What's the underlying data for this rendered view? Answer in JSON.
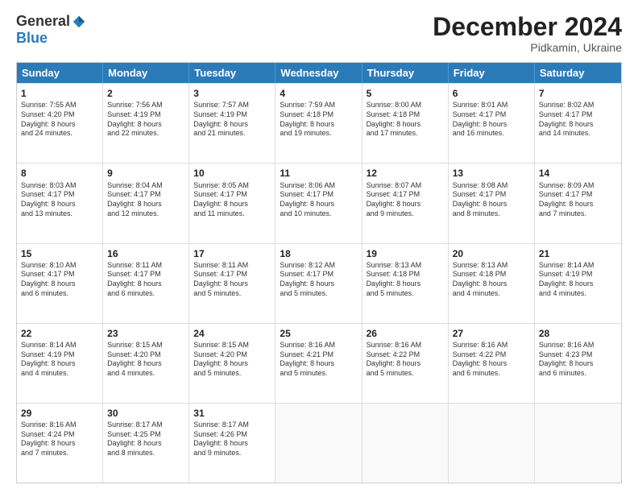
{
  "logo": {
    "general": "General",
    "blue": "Blue"
  },
  "header": {
    "month": "December 2024",
    "location": "Pidkamin, Ukraine"
  },
  "days": [
    "Sunday",
    "Monday",
    "Tuesday",
    "Wednesday",
    "Thursday",
    "Friday",
    "Saturday"
  ],
  "weeks": [
    [
      {
        "day": "1",
        "info": "Sunrise: 7:55 AM\nSunset: 4:20 PM\nDaylight: 8 hours\nand 24 minutes."
      },
      {
        "day": "2",
        "info": "Sunrise: 7:56 AM\nSunset: 4:19 PM\nDaylight: 8 hours\nand 22 minutes."
      },
      {
        "day": "3",
        "info": "Sunrise: 7:57 AM\nSunset: 4:19 PM\nDaylight: 8 hours\nand 21 minutes."
      },
      {
        "day": "4",
        "info": "Sunrise: 7:59 AM\nSunset: 4:18 PM\nDaylight: 8 hours\nand 19 minutes."
      },
      {
        "day": "5",
        "info": "Sunrise: 8:00 AM\nSunset: 4:18 PM\nDaylight: 8 hours\nand 17 minutes."
      },
      {
        "day": "6",
        "info": "Sunrise: 8:01 AM\nSunset: 4:17 PM\nDaylight: 8 hours\nand 16 minutes."
      },
      {
        "day": "7",
        "info": "Sunrise: 8:02 AM\nSunset: 4:17 PM\nDaylight: 8 hours\nand 14 minutes."
      }
    ],
    [
      {
        "day": "8",
        "info": "Sunrise: 8:03 AM\nSunset: 4:17 PM\nDaylight: 8 hours\nand 13 minutes."
      },
      {
        "day": "9",
        "info": "Sunrise: 8:04 AM\nSunset: 4:17 PM\nDaylight: 8 hours\nand 12 minutes."
      },
      {
        "day": "10",
        "info": "Sunrise: 8:05 AM\nSunset: 4:17 PM\nDaylight: 8 hours\nand 11 minutes."
      },
      {
        "day": "11",
        "info": "Sunrise: 8:06 AM\nSunset: 4:17 PM\nDaylight: 8 hours\nand 10 minutes."
      },
      {
        "day": "12",
        "info": "Sunrise: 8:07 AM\nSunset: 4:17 PM\nDaylight: 8 hours\nand 9 minutes."
      },
      {
        "day": "13",
        "info": "Sunrise: 8:08 AM\nSunset: 4:17 PM\nDaylight: 8 hours\nand 8 minutes."
      },
      {
        "day": "14",
        "info": "Sunrise: 8:09 AM\nSunset: 4:17 PM\nDaylight: 8 hours\nand 7 minutes."
      }
    ],
    [
      {
        "day": "15",
        "info": "Sunrise: 8:10 AM\nSunset: 4:17 PM\nDaylight: 8 hours\nand 6 minutes."
      },
      {
        "day": "16",
        "info": "Sunrise: 8:11 AM\nSunset: 4:17 PM\nDaylight: 8 hours\nand 6 minutes."
      },
      {
        "day": "17",
        "info": "Sunrise: 8:11 AM\nSunset: 4:17 PM\nDaylight: 8 hours\nand 5 minutes."
      },
      {
        "day": "18",
        "info": "Sunrise: 8:12 AM\nSunset: 4:17 PM\nDaylight: 8 hours\nand 5 minutes."
      },
      {
        "day": "19",
        "info": "Sunrise: 8:13 AM\nSunset: 4:18 PM\nDaylight: 8 hours\nand 5 minutes."
      },
      {
        "day": "20",
        "info": "Sunrise: 8:13 AM\nSunset: 4:18 PM\nDaylight: 8 hours\nand 4 minutes."
      },
      {
        "day": "21",
        "info": "Sunrise: 8:14 AM\nSunset: 4:19 PM\nDaylight: 8 hours\nand 4 minutes."
      }
    ],
    [
      {
        "day": "22",
        "info": "Sunrise: 8:14 AM\nSunset: 4:19 PM\nDaylight: 8 hours\nand 4 minutes."
      },
      {
        "day": "23",
        "info": "Sunrise: 8:15 AM\nSunset: 4:20 PM\nDaylight: 8 hours\nand 4 minutes."
      },
      {
        "day": "24",
        "info": "Sunrise: 8:15 AM\nSunset: 4:20 PM\nDaylight: 8 hours\nand 5 minutes."
      },
      {
        "day": "25",
        "info": "Sunrise: 8:16 AM\nSunset: 4:21 PM\nDaylight: 8 hours\nand 5 minutes."
      },
      {
        "day": "26",
        "info": "Sunrise: 8:16 AM\nSunset: 4:22 PM\nDaylight: 8 hours\nand 5 minutes."
      },
      {
        "day": "27",
        "info": "Sunrise: 8:16 AM\nSunset: 4:22 PM\nDaylight: 8 hours\nand 6 minutes."
      },
      {
        "day": "28",
        "info": "Sunrise: 8:16 AM\nSunset: 4:23 PM\nDaylight: 8 hours\nand 6 minutes."
      }
    ],
    [
      {
        "day": "29",
        "info": "Sunrise: 8:16 AM\nSunset: 4:24 PM\nDaylight: 8 hours\nand 7 minutes."
      },
      {
        "day": "30",
        "info": "Sunrise: 8:17 AM\nSunset: 4:25 PM\nDaylight: 8 hours\nand 8 minutes."
      },
      {
        "day": "31",
        "info": "Sunrise: 8:17 AM\nSunset: 4:26 PM\nDaylight: 8 hours\nand 9 minutes."
      },
      {
        "day": "",
        "info": ""
      },
      {
        "day": "",
        "info": ""
      },
      {
        "day": "",
        "info": ""
      },
      {
        "day": "",
        "info": ""
      }
    ]
  ]
}
